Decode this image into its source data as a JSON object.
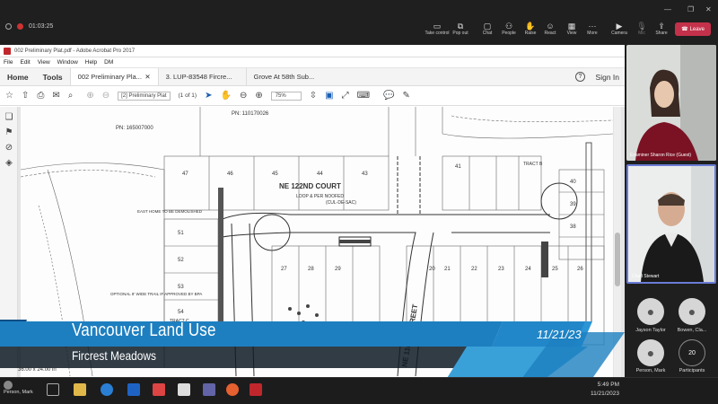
{
  "teams": {
    "timer": "01:03:25",
    "buttons": [
      {
        "label": "Take control",
        "icon": "screen-share-icon"
      },
      {
        "label": "Pop out",
        "icon": "pop-out-icon"
      },
      {
        "label": "Chat",
        "icon": "chat-icon"
      },
      {
        "label": "People",
        "icon": "people-icon"
      },
      {
        "label": "Raise",
        "icon": "raise-hand-icon"
      },
      {
        "label": "React",
        "icon": "react-icon"
      },
      {
        "label": "View",
        "icon": "view-icon"
      },
      {
        "label": "More",
        "icon": "more-icon"
      },
      {
        "label": "Camera",
        "icon": "camera-icon"
      },
      {
        "label": "Mic",
        "icon": "mic-icon"
      },
      {
        "label": "Share",
        "icon": "share-icon"
      }
    ],
    "leave_label": "Leave",
    "leave_color": "#c4314b"
  },
  "acrobat": {
    "window_title": "002 Preliminary Plat.pdf - Adobe Acrobat Pro 2017",
    "menu": [
      "File",
      "Edit",
      "View",
      "Window",
      "Help",
      "DM"
    ],
    "home_tab": "Home",
    "tools_tab": "Tools",
    "doc_tabs": [
      {
        "label": "002 Preliminary Pla...",
        "active": true
      },
      {
        "label": "3. LUP-83548 Fircre...",
        "active": false
      },
      {
        "label": "Grove At 58th Sub...",
        "active": false
      }
    ],
    "sign_in": "Sign In",
    "page_field": "[2] Preliminary Plat",
    "page_count": "(1 of 1)",
    "zoom": "75%",
    "page_dims": "36.00 x 24.00 in"
  },
  "plat": {
    "labels": {
      "pn1": "PN: 110170026",
      "pn2": "PN: 165007000",
      "court": "NE 122ND COURT",
      "loop": "LOOP & PER NOOFED",
      "cul": "(CUL-DE-SAC)",
      "street": "NE 116TH STREET",
      "east_home": "EAST HOME TO BE DEMOLISHED",
      "trail": "OPTIONAL 8' WIDE TRAIL IF APPROVED BY BPA",
      "tract_c": "TRACT C",
      "tract_b": "TRACT B"
    },
    "lots_top": [
      "47",
      "46",
      "45",
      "44",
      "43"
    ],
    "lots_right": [
      "41",
      "40",
      "39",
      "38"
    ],
    "lots_left": [
      "51",
      "52",
      "53",
      "54"
    ],
    "lots_bottom": [
      "20",
      "21",
      "22",
      "23",
      "24",
      "25",
      "26",
      "27",
      "28",
      "29"
    ]
  },
  "lower_third": {
    "title": "Vancouver Land Use",
    "subtitle": "Fircrest Meadows",
    "date": "11/21/23",
    "color": "#1d7fc0"
  },
  "participants": {
    "tile1_name": "Examiner Sharon Rice (Guest)",
    "tile2_name": "Chad Stewart",
    "avatars": [
      {
        "name": "Jayson Taylor"
      },
      {
        "name": "Bowen, Cla..."
      },
      {
        "name": "Person, Mark"
      }
    ],
    "count": "20",
    "count_label": "Participants"
  },
  "taskbar": {
    "user": "Person, Mark",
    "time": "5:49 PM",
    "date": "11/21/2023"
  }
}
